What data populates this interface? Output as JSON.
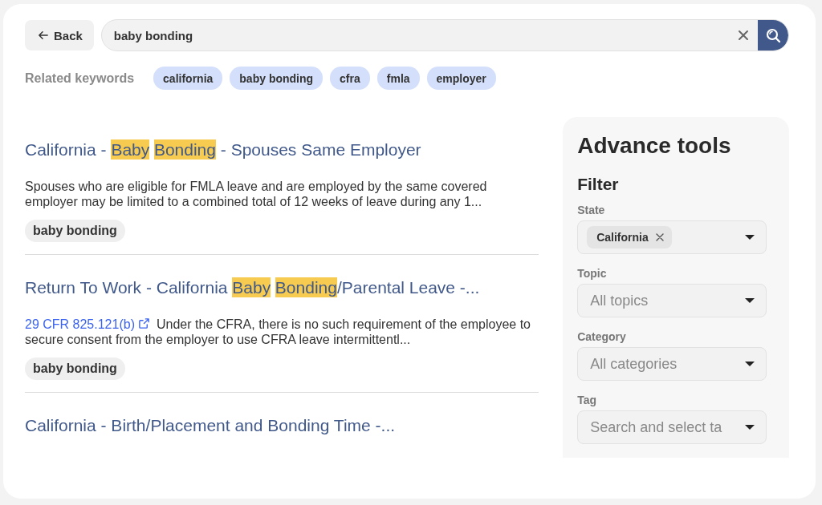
{
  "back_button": {
    "label": "Back"
  },
  "search": {
    "value": "baby bonding"
  },
  "related_keywords": {
    "label": "Related keywords",
    "items": [
      "california",
      "baby bonding",
      "cfra",
      "fmla",
      "employer"
    ]
  },
  "results": [
    {
      "title": [
        {
          "text": "California - ",
          "highlight": false
        },
        {
          "text": "Baby ",
          "highlight": true
        },
        {
          "text": "Bonding",
          "highlight": true
        },
        {
          "text": " - Spouses Same Employer",
          "highlight": false
        }
      ],
      "snippet": "Spouses who are eligible for FMLA leave and are employed by the same covered employer may be limited to a combined total of 12 weeks of leave during any 1...",
      "tags": [
        "baby bonding"
      ]
    },
    {
      "title": [
        {
          "text": "Return To Work - California ",
          "highlight": false
        },
        {
          "text": "Baby ",
          "highlight": true
        },
        {
          "text": "Bonding",
          "highlight": true
        },
        {
          "text": "/Parental Leave -...",
          "highlight": false
        }
      ],
      "citation": "29 CFR 825.121(b)",
      "snippet": "Under the CFRA, there is no such requirement of the employee to secure consent from the employer to use CFRA leave intermittentl...",
      "tags": [
        "baby bonding"
      ]
    },
    {
      "title": [
        {
          "text": "California - Birth/Placement and Bonding Time -...",
          "highlight": false
        }
      ]
    }
  ],
  "advance_tools": {
    "title": "Advance tools",
    "filter_title": "Filter",
    "filters": [
      {
        "label": "State",
        "chips": [
          "California"
        ]
      },
      {
        "label": "Topic",
        "placeholder": "All topics"
      },
      {
        "label": "Category",
        "placeholder": "All categories"
      },
      {
        "label": "Tag",
        "placeholder": "Search and select ta"
      }
    ]
  }
}
